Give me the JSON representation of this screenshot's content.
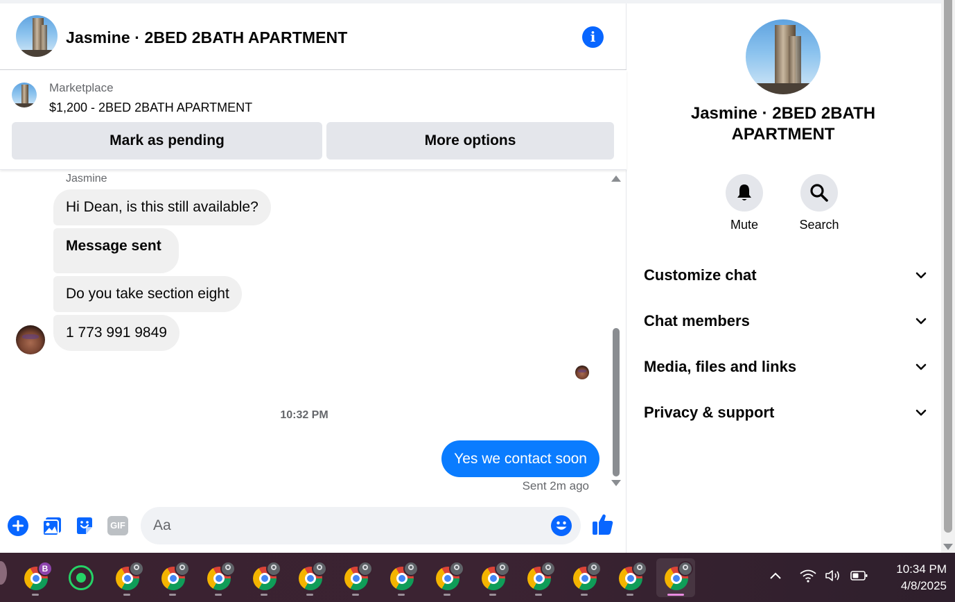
{
  "header": {
    "title": "Jasmine · 2BED 2BATH APARTMENT",
    "info_icon": "info-icon"
  },
  "listing": {
    "label": "Marketplace",
    "price_title": "$1,200 - 2BED 2BATH APARTMENT",
    "mark_pending_label": "Mark as pending",
    "more_options_label": "More options"
  },
  "conversation": {
    "sender_name": "Jasmine",
    "incoming": [
      {
        "text": "Hi Dean, is this still available?"
      },
      {
        "text": "Message sent"
      },
      {
        "text": "Do you take section eight"
      },
      {
        "text": "1 773 991 9849"
      }
    ],
    "timestamp": "10:32 PM",
    "outgoing": [
      {
        "text": "Yes we contact soon"
      }
    ],
    "sent_status": "Sent 2m ago"
  },
  "composer": {
    "placeholder": "Aa",
    "icons": [
      "plus-icon",
      "photo-icon",
      "sticker-icon",
      "gif-icon",
      "emoji-icon",
      "thumbs-up-icon"
    ],
    "gif_label": "GIF"
  },
  "panel": {
    "name": "Jasmine · 2BED 2BATH APARTMENT",
    "actions": [
      {
        "label": "Mute",
        "icon": "bell-icon"
      },
      {
        "label": "Search",
        "icon": "search-icon"
      }
    ],
    "sections": [
      {
        "label": "Customize chat"
      },
      {
        "label": "Chat members"
      },
      {
        "label": "Media, files and links"
      },
      {
        "label": "Privacy & support"
      }
    ]
  },
  "taskbar": {
    "profile_badge": "B",
    "time": "10:34 PM",
    "date": "4/8/2025"
  },
  "colors": {
    "accent": "#0866ff",
    "outgoing_bubble": "#0a7cff",
    "incoming_bubble": "#f0f0f0",
    "button_bg": "#e4e6eb",
    "secondary_text": "#65676b"
  }
}
